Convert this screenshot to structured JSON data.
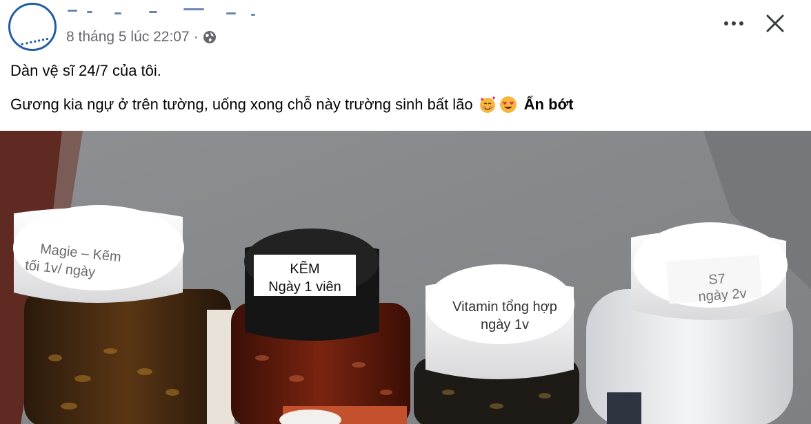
{
  "post": {
    "timestamp": "8 tháng 5 lúc 22:07",
    "separator": "·",
    "line1": "Dàn vệ sĩ 24/7 của tôi.",
    "line2": "Gương kia ngự ở trên tường, uống xong chỗ này trường sinh bất lão",
    "see_less": "Ẩn bớt",
    "icons": {
      "privacy": "globe-icon",
      "more": "more-icon",
      "close": "close-icon",
      "emoji1": "smiling-face-with-hearts-emoji",
      "emoji2": "heart-eyes-emoji"
    }
  },
  "photo": {
    "bottle1": {
      "line1": "Magie – Kẽm",
      "line2": "tối 1v/ ngày"
    },
    "bottle2": {
      "line1": "KẼM",
      "line2": "Ngày 1 viên"
    },
    "bottle3": {
      "line1": "Vitamin tổng hợp",
      "line2": "ngày 1v"
    },
    "bottle4": {
      "line1": "S7",
      "line2": "ngày 2v"
    }
  },
  "colors": {
    "meta_gray": "#65676b",
    "text": "#050505",
    "avatar_ring": "#1f5ca8"
  }
}
